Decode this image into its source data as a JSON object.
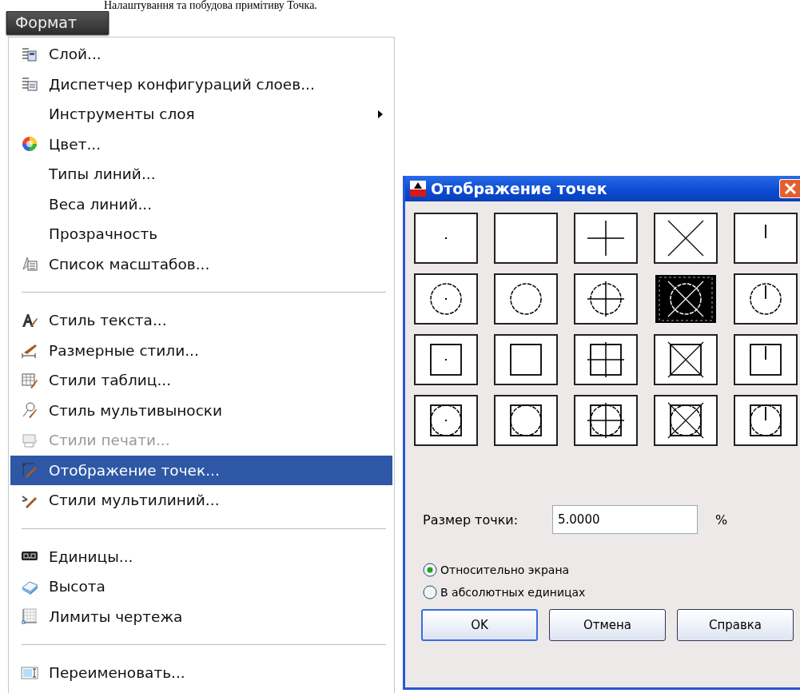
{
  "heading": "Налаштування та побудова примітиву Точка.",
  "menu_bar": {
    "title": "Формат"
  },
  "menu": {
    "items": [
      {
        "kind": "item",
        "label": "Слой...",
        "has_submenu": false,
        "disabled": false,
        "selected": false
      },
      {
        "kind": "item",
        "label": "Диспетчер конфигураций слоев...",
        "has_submenu": false,
        "disabled": false,
        "selected": false
      },
      {
        "kind": "item",
        "label": "Инструменты слоя",
        "has_submenu": true,
        "disabled": false,
        "selected": false
      },
      {
        "kind": "item",
        "label": "Цвет...",
        "has_submenu": false,
        "disabled": false,
        "selected": false
      },
      {
        "kind": "item",
        "label": "Типы линий...",
        "has_submenu": false,
        "disabled": false,
        "selected": false
      },
      {
        "kind": "item",
        "label": "Веса линий...",
        "has_submenu": false,
        "disabled": false,
        "selected": false
      },
      {
        "kind": "item",
        "label": "Прозрачность",
        "has_submenu": false,
        "disabled": false,
        "selected": false
      },
      {
        "kind": "item",
        "label": "Список масштабов...",
        "has_submenu": false,
        "disabled": false,
        "selected": false
      },
      {
        "kind": "separator"
      },
      {
        "kind": "item",
        "label": "Стиль текста...",
        "has_submenu": false,
        "disabled": false,
        "selected": false
      },
      {
        "kind": "item",
        "label": "Размерные стили...",
        "has_submenu": false,
        "disabled": false,
        "selected": false
      },
      {
        "kind": "item",
        "label": "Стили таблиц...",
        "has_submenu": false,
        "disabled": false,
        "selected": false
      },
      {
        "kind": "item",
        "label": "Стиль мультивыноски",
        "has_submenu": false,
        "disabled": false,
        "selected": false
      },
      {
        "kind": "item",
        "label": "Стили печати...",
        "has_submenu": false,
        "disabled": true,
        "selected": false
      },
      {
        "kind": "item",
        "label": "Отображение точек...",
        "has_submenu": false,
        "disabled": false,
        "selected": true
      },
      {
        "kind": "item",
        "label": "Стили мультилиний...",
        "has_submenu": false,
        "disabled": false,
        "selected": false
      },
      {
        "kind": "separator"
      },
      {
        "kind": "item",
        "label": "Единицы...",
        "has_submenu": false,
        "disabled": false,
        "selected": false
      },
      {
        "kind": "item",
        "label": "Высота",
        "has_submenu": false,
        "disabled": false,
        "selected": false
      },
      {
        "kind": "item",
        "label": "Лимиты чертежа",
        "has_submenu": false,
        "disabled": false,
        "selected": false
      },
      {
        "kind": "separator"
      },
      {
        "kind": "item",
        "label": "Переименовать...",
        "has_submenu": false,
        "disabled": false,
        "selected": false
      }
    ]
  },
  "dialog": {
    "title": "Отображение точек",
    "point_styles": [
      {
        "kind": "dot",
        "circle": false,
        "square": false,
        "selected": false
      },
      {
        "kind": "none",
        "circle": false,
        "square": false,
        "selected": false
      },
      {
        "kind": "plus",
        "circle": false,
        "square": false,
        "selected": false
      },
      {
        "kind": "cross",
        "circle": false,
        "square": false,
        "selected": false
      },
      {
        "kind": "tick",
        "circle": false,
        "square": false,
        "selected": false
      },
      {
        "kind": "dot",
        "circle": true,
        "square": false,
        "selected": false
      },
      {
        "kind": "none",
        "circle": true,
        "square": false,
        "selected": false
      },
      {
        "kind": "plus",
        "circle": true,
        "square": false,
        "selected": false
      },
      {
        "kind": "cross",
        "circle": true,
        "square": false,
        "selected": true
      },
      {
        "kind": "tick",
        "circle": true,
        "square": false,
        "selected": false
      },
      {
        "kind": "dot",
        "circle": false,
        "square": true,
        "selected": false
      },
      {
        "kind": "none",
        "circle": false,
        "square": true,
        "selected": false
      },
      {
        "kind": "plus",
        "circle": false,
        "square": true,
        "selected": false
      },
      {
        "kind": "cross",
        "circle": false,
        "square": true,
        "selected": false
      },
      {
        "kind": "tick",
        "circle": false,
        "square": true,
        "selected": false
      },
      {
        "kind": "dot",
        "circle": true,
        "square": true,
        "selected": false
      },
      {
        "kind": "none",
        "circle": true,
        "square": true,
        "selected": false
      },
      {
        "kind": "plus",
        "circle": true,
        "square": true,
        "selected": false
      },
      {
        "kind": "cross",
        "circle": true,
        "square": true,
        "selected": false
      },
      {
        "kind": "tick",
        "circle": true,
        "square": true,
        "selected": false
      }
    ],
    "size": {
      "label": "Размер точки:",
      "value": "5.0000",
      "unit": "%"
    },
    "modes": [
      {
        "label": "Относительно экрана",
        "selected": true
      },
      {
        "label": "В абсолютных единицах",
        "selected": false
      }
    ],
    "buttons": [
      {
        "label": "OK",
        "default": true
      },
      {
        "label": "Отмена",
        "default": false
      },
      {
        "label": "Справка",
        "default": false
      }
    ]
  }
}
